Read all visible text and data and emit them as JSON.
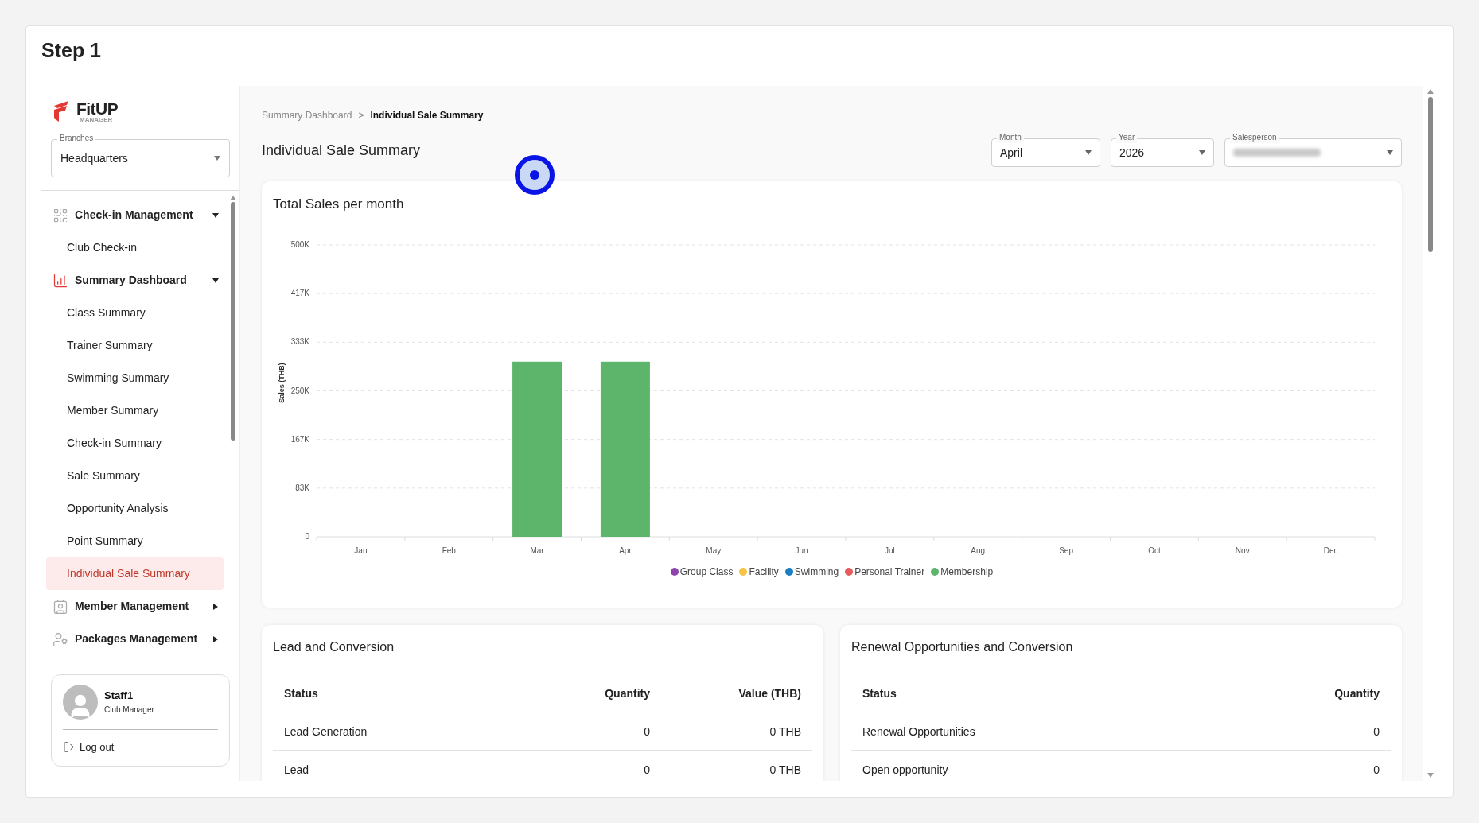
{
  "step_title": "Step 1",
  "brand": {
    "name": "FitUP",
    "tagline": "MANAGER"
  },
  "branch_select": {
    "label": "Branches",
    "value": "Headquarters"
  },
  "sidebar": {
    "items": [
      {
        "kind": "group",
        "label": "Check-in Management",
        "expanded": true,
        "children": [
          {
            "label": "Club Check-in",
            "selected": false
          }
        ]
      },
      {
        "kind": "group",
        "label": "Summary Dashboard",
        "expanded": true,
        "children": [
          {
            "label": "Class Summary",
            "selected": false
          },
          {
            "label": "Trainer Summary",
            "selected": false
          },
          {
            "label": "Swimming Summary",
            "selected": false
          },
          {
            "label": "Member Summary",
            "selected": false
          },
          {
            "label": "Check-in Summary",
            "selected": false
          },
          {
            "label": "Sale Summary",
            "selected": false
          },
          {
            "label": "Opportunity Analysis",
            "selected": false
          },
          {
            "label": "Point Summary",
            "selected": false
          },
          {
            "label": "Individual Sale Summary",
            "selected": true
          }
        ]
      },
      {
        "kind": "group",
        "label": "Member Management",
        "expanded": false
      },
      {
        "kind": "group",
        "label": "Packages Management",
        "expanded": false
      }
    ]
  },
  "user": {
    "name": "Staff1",
    "role": "Club Manager",
    "logout": "Log out"
  },
  "breadcrumb": [
    {
      "label": "Summary Dashboard",
      "current": false
    },
    {
      "label": "Individual Sale Summary",
      "current": true
    }
  ],
  "breadcrumb_separator": ">",
  "page_title": "Individual Sale Summary",
  "click_marker": true,
  "filters": [
    {
      "label": "Month",
      "value": "April",
      "blurred": false
    },
    {
      "label": "Year",
      "value": "2026",
      "blurred": false
    },
    {
      "label": "Salesperson",
      "blurred": true
    }
  ],
  "sales_chart": {
    "title": "Total Sales per month",
    "chart_data": {
      "type": "bar",
      "stacked": true,
      "grid": true,
      "ylabel": "Sales (THB)",
      "categories": [
        "Jan",
        "Feb",
        "Mar",
        "Apr",
        "May",
        "Jun",
        "Jul",
        "Aug",
        "Sep",
        "Oct",
        "Nov",
        "Dec"
      ],
      "ylim": [
        0,
        500000
      ],
      "yticks": [
        {
          "value": 0,
          "label": "0"
        },
        {
          "value": 83333,
          "label": "83K"
        },
        {
          "value": 166667,
          "label": "167K"
        },
        {
          "value": 250000,
          "label": "250K"
        },
        {
          "value": 333333,
          "label": "333K"
        },
        {
          "value": 416667,
          "label": "417K"
        },
        {
          "value": 500000,
          "label": "500K"
        }
      ],
      "series": [
        {
          "name": "Group Class",
          "color": "#8e44ad",
          "values": [
            0,
            0,
            0,
            0,
            0,
            0,
            0,
            0,
            0,
            0,
            0,
            0
          ]
        },
        {
          "name": "Facility",
          "color": "#f4c542",
          "values": [
            0,
            0,
            0,
            0,
            0,
            0,
            0,
            0,
            0,
            0,
            0,
            0
          ]
        },
        {
          "name": "Swimming",
          "color": "#1a7fc1",
          "values": [
            0,
            0,
            0,
            0,
            0,
            0,
            0,
            0,
            0,
            0,
            0,
            0
          ]
        },
        {
          "name": "Personal Trainer",
          "color": "#e85b5b",
          "values": [
            0,
            0,
            0,
            0,
            0,
            0,
            0,
            0,
            0,
            0,
            0,
            0
          ]
        },
        {
          "name": "Membership",
          "color": "#5cb56b",
          "values": [
            0,
            0,
            300000,
            300000,
            0,
            0,
            0,
            0,
            0,
            0,
            0,
            0
          ]
        }
      ]
    }
  },
  "lead_table": {
    "title": "Lead and Conversion",
    "columns": [
      "Status",
      "Quantity",
      "Value (THB)"
    ],
    "rows": [
      [
        "Lead Generation",
        "0",
        "0 THB"
      ],
      [
        "Lead",
        "0",
        "0 THB"
      ]
    ]
  },
  "renewal_table": {
    "title": "Renewal Opportunities and Conversion",
    "columns": [
      "Status",
      "Quantity"
    ],
    "rows": [
      [
        "Renewal Opportunities",
        "0"
      ],
      [
        "Open opportunity",
        "0"
      ]
    ]
  }
}
